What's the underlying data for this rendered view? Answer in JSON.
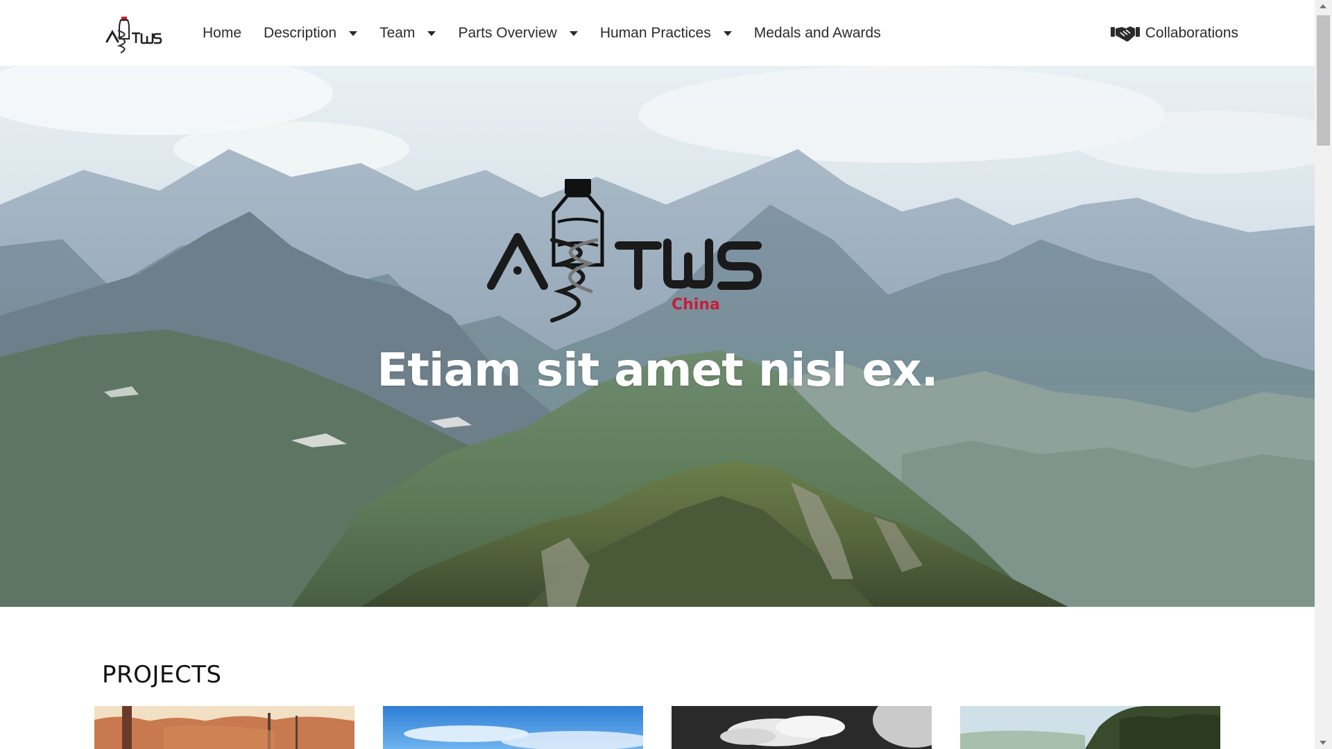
{
  "nav": {
    "brand_logo_text": "ASTWS",
    "items": [
      {
        "label": "Home",
        "dropdown": false
      },
      {
        "label": "Description",
        "dropdown": true
      },
      {
        "label": "Team",
        "dropdown": true
      },
      {
        "label": "Parts Overview",
        "dropdown": true
      },
      {
        "label": "Human Practices",
        "dropdown": true
      },
      {
        "label": "Medals and Awards",
        "dropdown": false
      }
    ],
    "collaborations": {
      "label": "Collaborations",
      "icon": "handshake-icon"
    }
  },
  "hero": {
    "logo_text": "ASTWS",
    "logo_subtext": "China",
    "title": "Etiam sit amet nisl ex."
  },
  "projects": {
    "heading": "PROJECTS",
    "cards": [
      {
        "name": "project-card-autumn",
        "icon": "autumn-landscape-image"
      },
      {
        "name": "project-card-sky",
        "icon": "blue-sky-image"
      },
      {
        "name": "project-card-clouds",
        "icon": "monochrome-clouds-image"
      },
      {
        "name": "project-card-forest",
        "icon": "forest-hill-image"
      }
    ]
  },
  "colors": {
    "accent_red": "#c41e3a",
    "text_dark": "#2b2b2b"
  }
}
